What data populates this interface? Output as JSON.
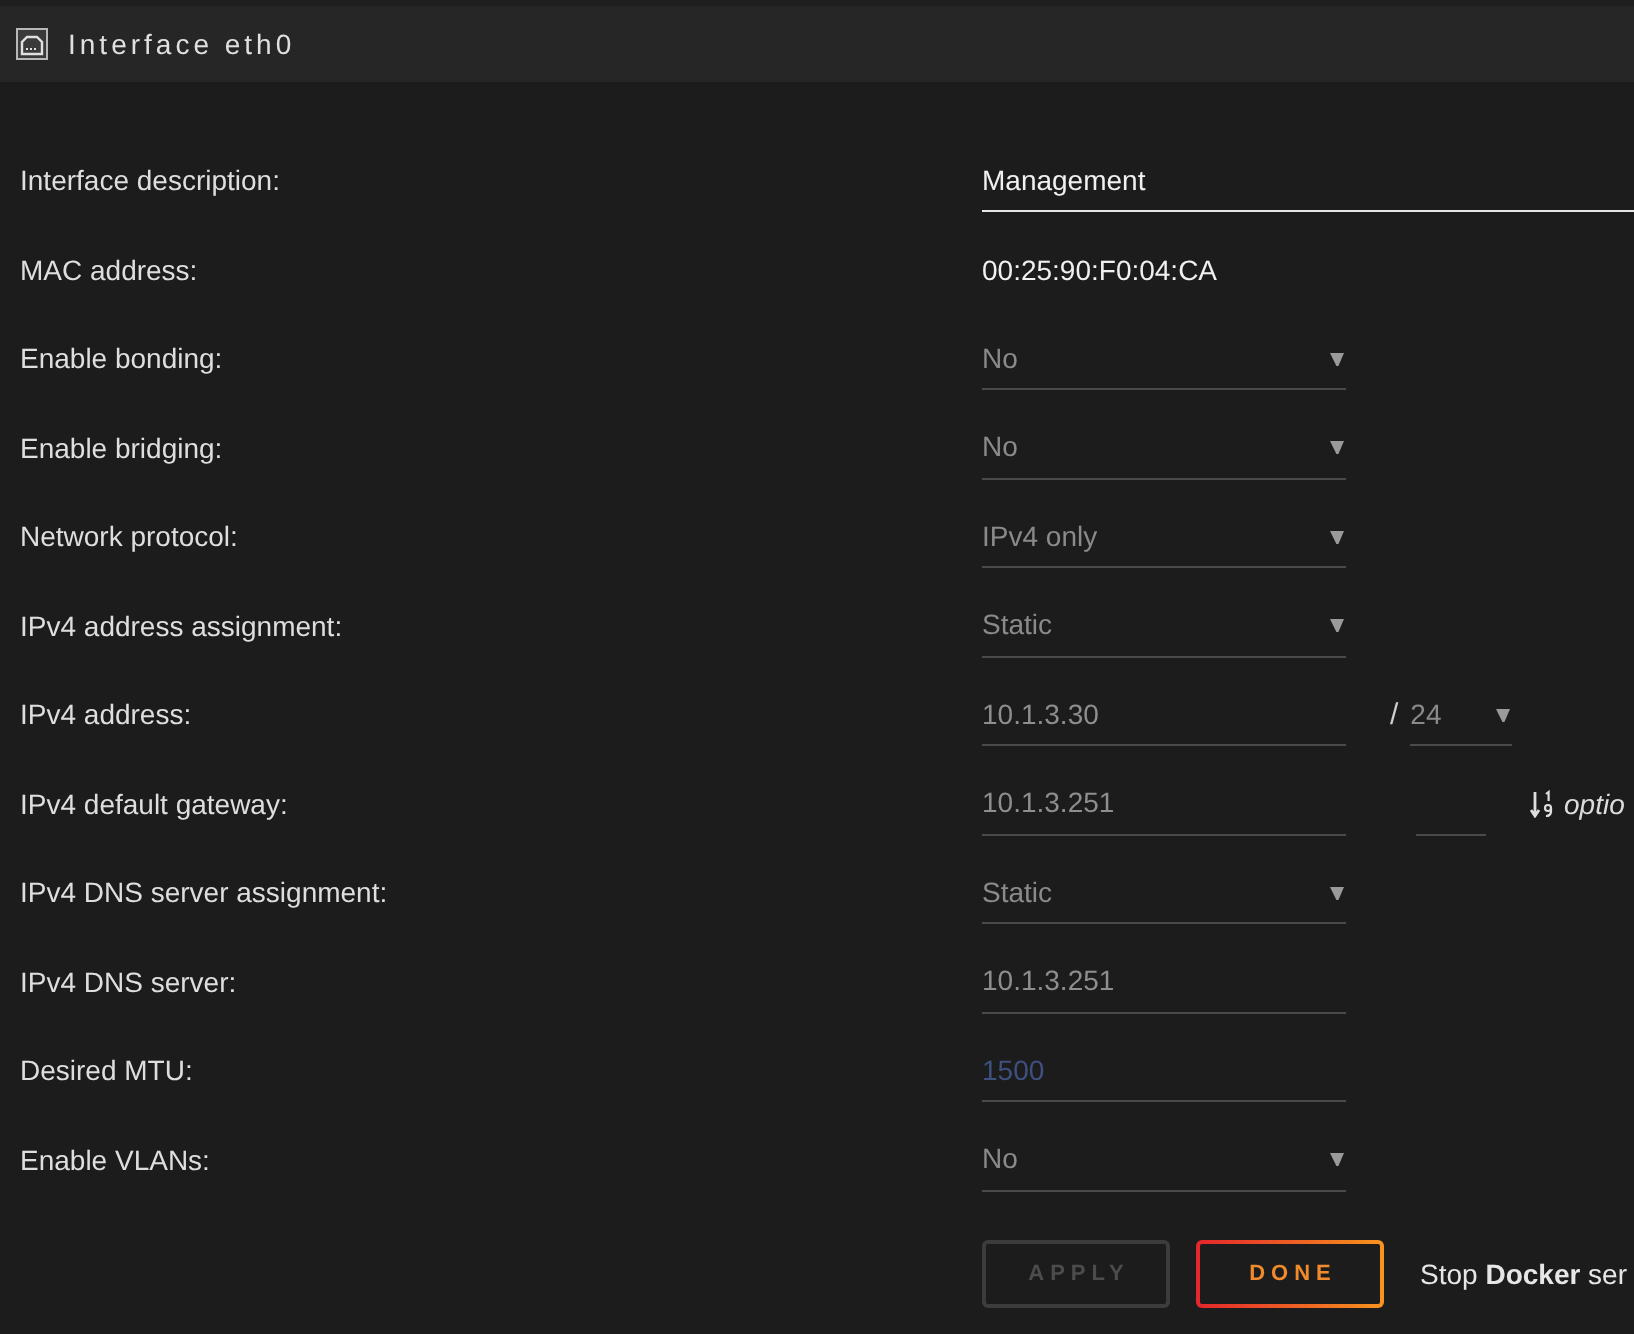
{
  "window": {
    "title": "Interface eth0"
  },
  "fields": [
    {
      "label": "Interface description:",
      "kind": "wide-input",
      "value": "Management",
      "disabled": false
    },
    {
      "label": "MAC address:",
      "kind": "text",
      "value": "00:25:90:F0:04:CA",
      "disabled": false
    },
    {
      "label": "Enable bonding:",
      "kind": "select",
      "value": "No",
      "disabled": true
    },
    {
      "label": "Enable bridging:",
      "kind": "select",
      "value": "No",
      "disabled": true
    },
    {
      "label": "Network protocol:",
      "kind": "select",
      "value": "IPv4 only",
      "disabled": true
    },
    {
      "label": "IPv4 address assignment:",
      "kind": "select",
      "value": "Static",
      "disabled": true
    },
    {
      "label": "IPv4 address:",
      "kind": "input",
      "value": "10.1.3.30",
      "disabled": true,
      "prefix": {
        "separator": "/",
        "value": "24",
        "disabled": true
      }
    },
    {
      "label": "IPv4 default gateway:",
      "kind": "input",
      "value": "10.1.3.251",
      "disabled": true,
      "metric": {
        "note": "optio"
      }
    },
    {
      "label": "IPv4 DNS server assignment:",
      "kind": "select",
      "value": "Static",
      "disabled": true
    },
    {
      "label": "IPv4 DNS server:",
      "kind": "input",
      "value": "10.1.3.251",
      "disabled": true
    },
    {
      "label": "Desired MTU:",
      "kind": "input",
      "placeholder": "1500",
      "disabled": true
    },
    {
      "label": "Enable VLANs:",
      "kind": "select",
      "value": "No",
      "disabled": true
    }
  ],
  "buttons": [
    {
      "label": "APPLY",
      "disabled": true
    },
    {
      "label": "DONE",
      "disabled": false
    }
  ],
  "note": "Stop **Docker** ser"
}
